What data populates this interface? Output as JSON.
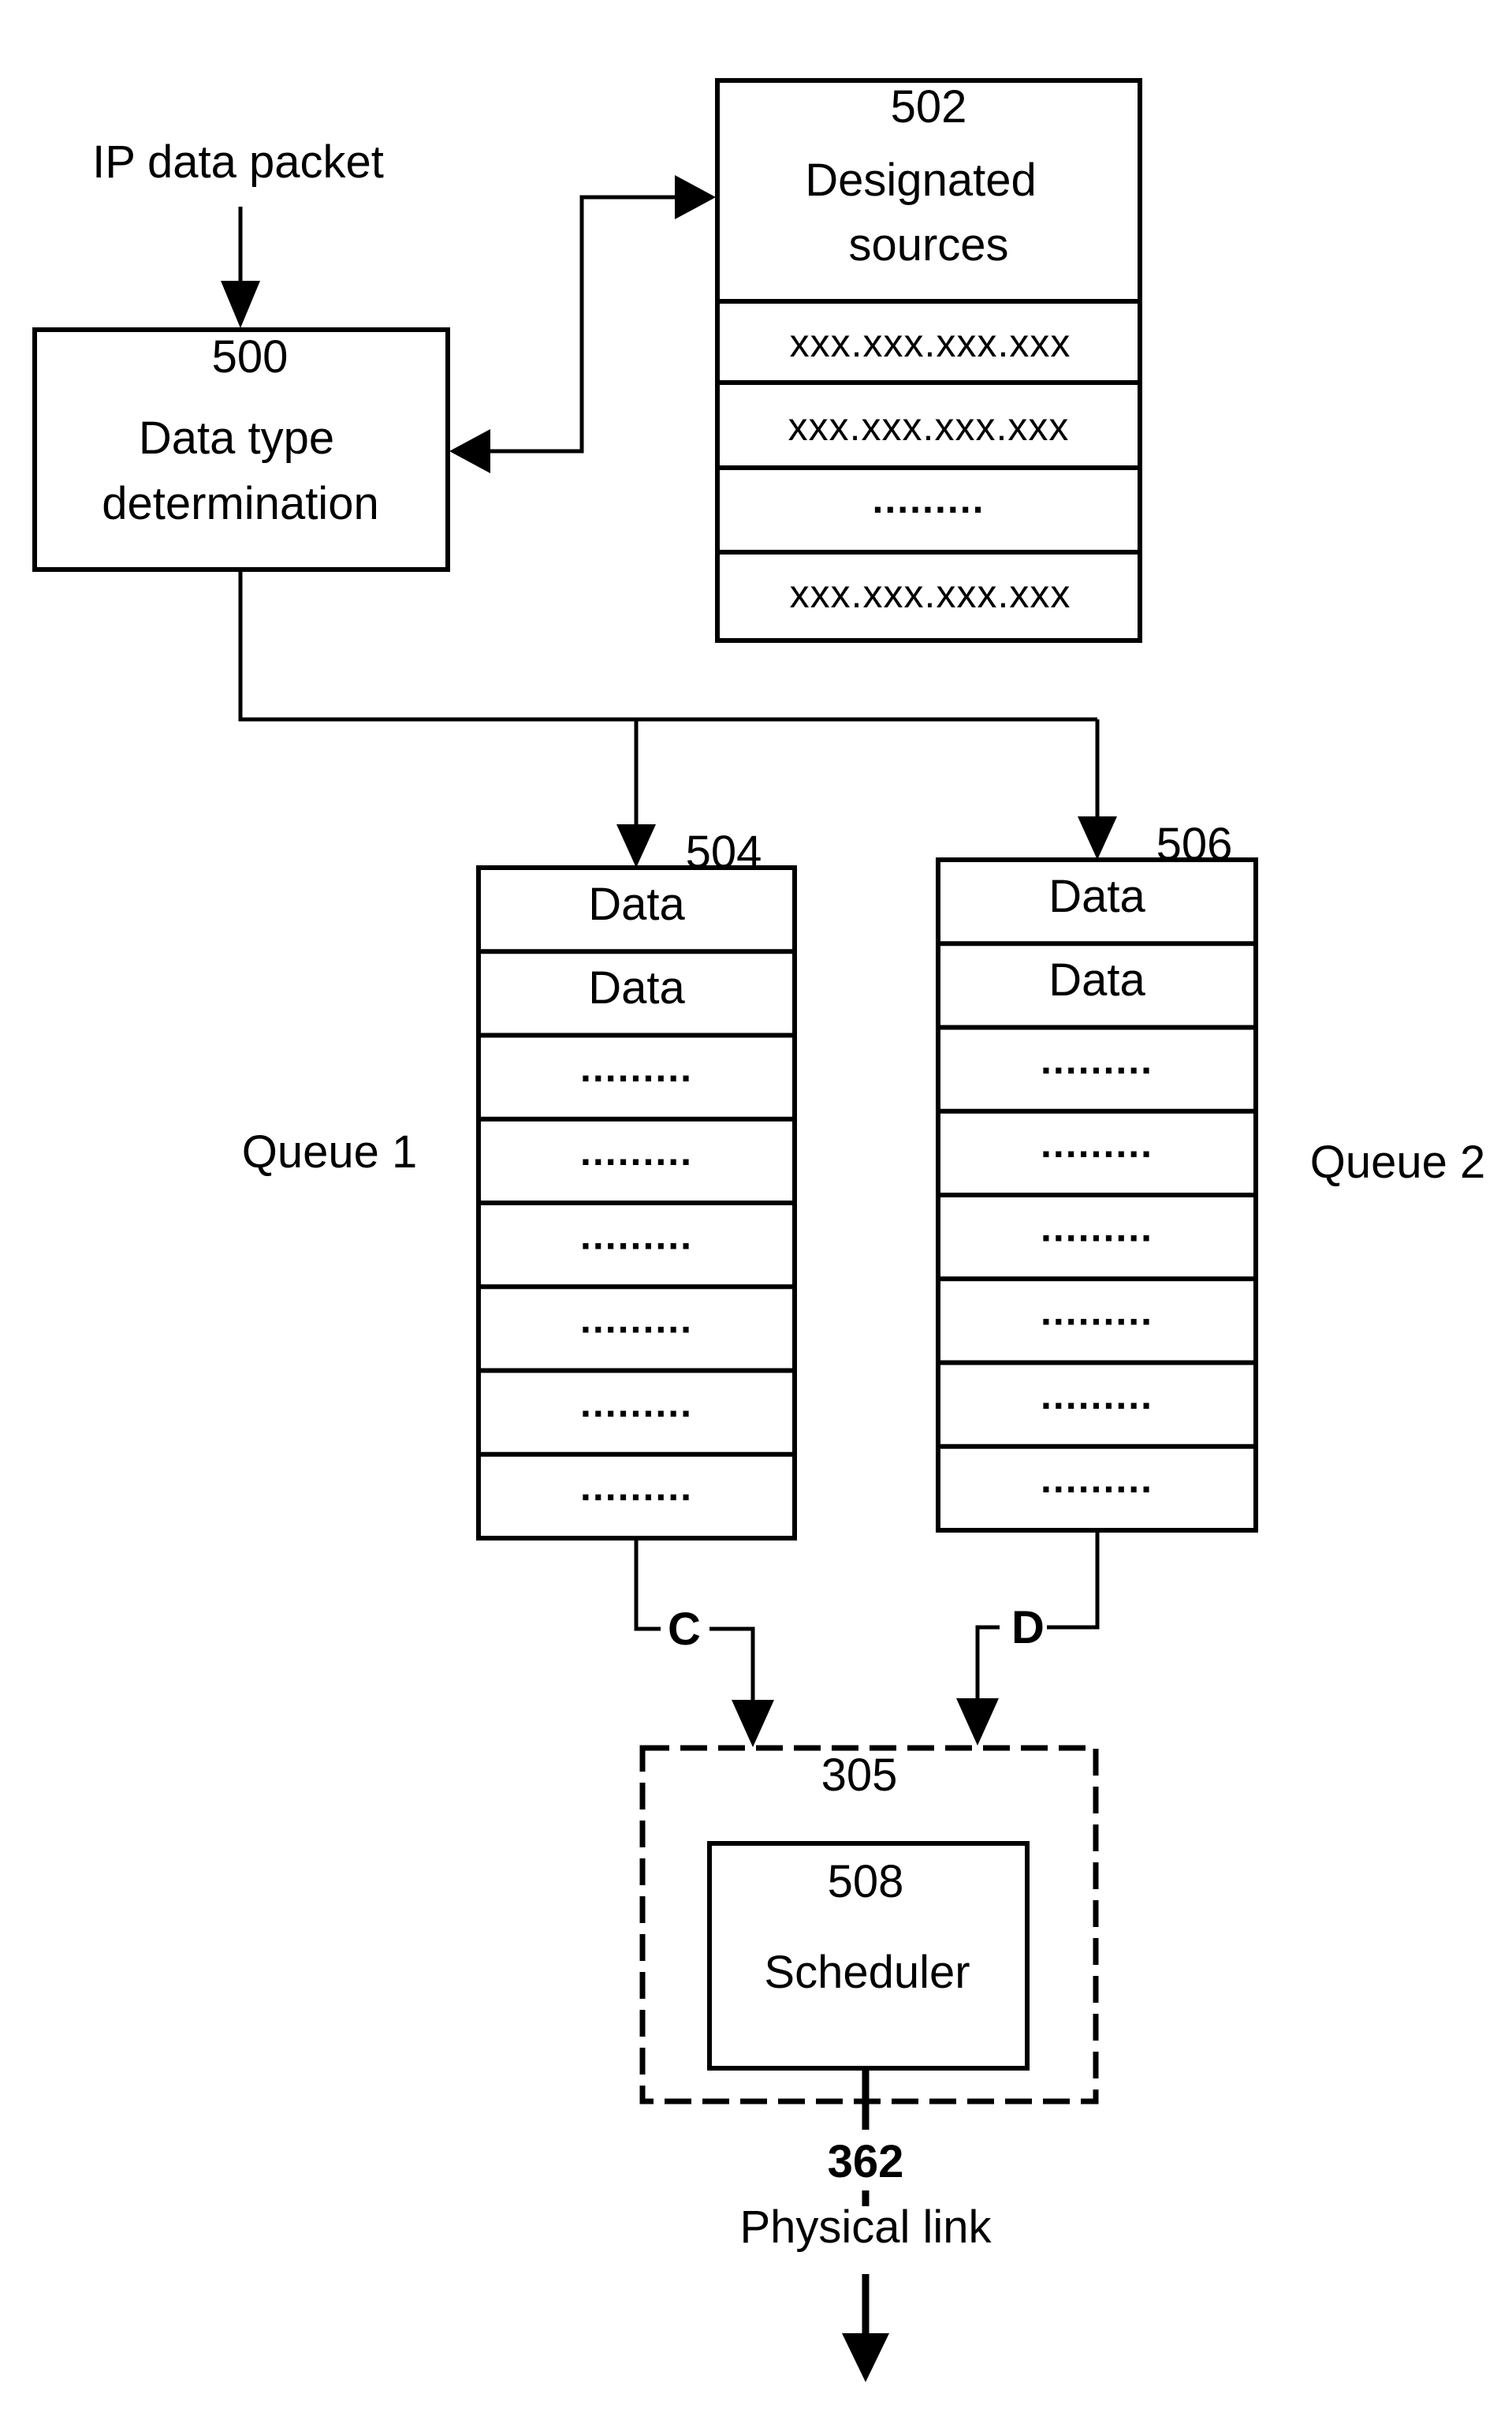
{
  "diagram": {
    "input_label": "IP data packet",
    "determination_block": {
      "ref": "500",
      "line1": "Data type",
      "line2": "determination"
    },
    "sources_table": {
      "ref": "502",
      "title_line1": "Designated",
      "title_line2": "sources",
      "rows": [
        "xxx.xxx.xxx.xxx",
        "xxx.xxx.xxx.xxx",
        ".........",
        "xxx.xxx.xxx.xxx"
      ]
    },
    "queue1": {
      "ref": "504",
      "label": "Queue 1",
      "cells": [
        "Data",
        "Data",
        ".........",
        ".........",
        ".........",
        ".........",
        ".........",
        "........."
      ]
    },
    "queue2": {
      "ref": "506",
      "label": "Queue 2",
      "cells": [
        "Data",
        "Data",
        ".........",
        ".........",
        ".........",
        ".........",
        ".........",
        "........."
      ]
    },
    "connector_c": "C",
    "connector_d": "D",
    "container": {
      "ref": "305"
    },
    "scheduler": {
      "ref": "508",
      "label": "Scheduler"
    },
    "link_ref": "362",
    "output_label": "Physical link"
  }
}
